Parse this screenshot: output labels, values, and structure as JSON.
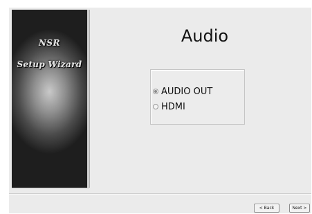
{
  "sidebar": {
    "brand": "NSR",
    "title": "Setup Wizard"
  },
  "page": {
    "title": "Audio"
  },
  "audio_options": {
    "selected": "AUDIO OUT",
    "items": [
      {
        "label": "AUDIO OUT",
        "checked": true
      },
      {
        "label": "HDMI",
        "checked": false
      }
    ]
  },
  "footer": {
    "back_label": "< Back",
    "next_label": "Next >"
  }
}
